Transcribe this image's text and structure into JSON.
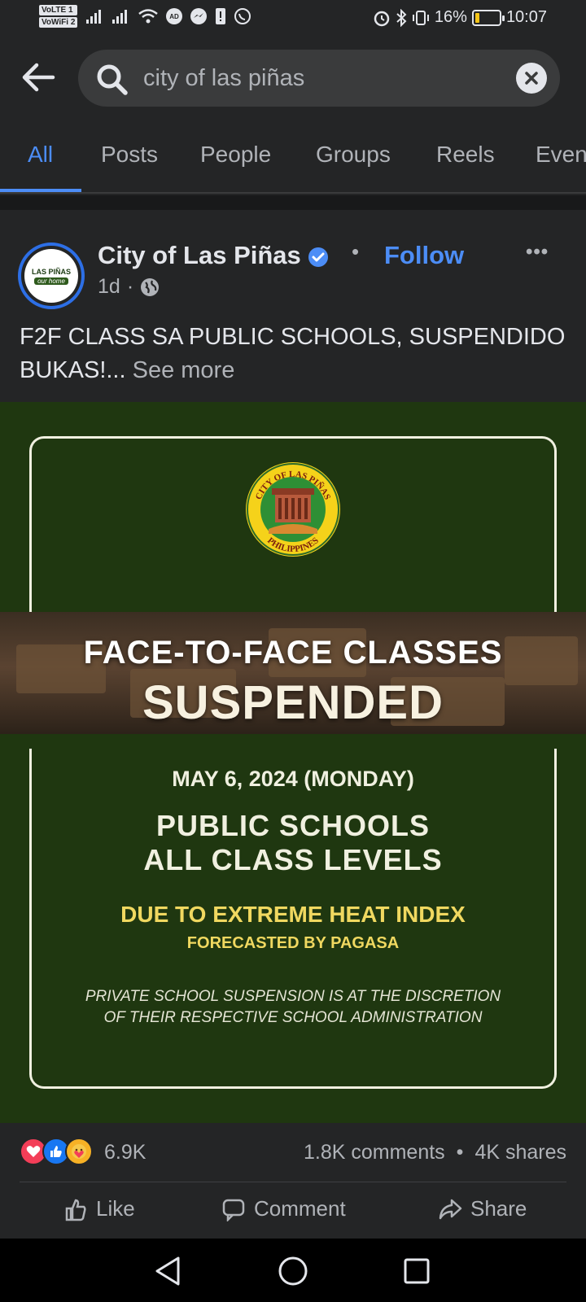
{
  "status_bar": {
    "volte": "VoLTE 1",
    "vowifi": "VoWiFi 2",
    "battery_percent": "16%",
    "battery_level": 0.16,
    "time": "10:07",
    "icons": [
      "signal-icon",
      "signal-icon",
      "wifi-icon",
      "ad-blocker-icon",
      "messenger-icon",
      "notification-icon",
      "viber-icon",
      "alarm-icon",
      "bluetooth-icon",
      "vibrate-icon",
      "battery-icon"
    ]
  },
  "search": {
    "value": "city of las piñas",
    "back_icon": "back-arrow-icon",
    "search_icon": "search-icon",
    "clear_icon": "clear-icon"
  },
  "tabs": [
    {
      "label": "All",
      "active": true
    },
    {
      "label": "Posts"
    },
    {
      "label": "People"
    },
    {
      "label": "Groups"
    },
    {
      "label": "Reels"
    },
    {
      "label": "Events"
    }
  ],
  "post": {
    "page_name": "City of Las Piñas",
    "verified": true,
    "follow_label": "Follow",
    "time": "1d",
    "privacy_icon": "globe-icon",
    "separator": "•",
    "meta_separator": "·",
    "more_label": "•••",
    "caption": "F2F CLASS SA PUBLIC SCHOOLS, SUSPENDIDO BUKAS!...",
    "see_more": "See more",
    "avatar": {
      "title": "LAS PIÑAS",
      "subtitle": "our home"
    },
    "image": {
      "seal_top_text": "CITY OF LAS PIÑAS",
      "seal_bottom_text": "PHILIPPINES",
      "banner_line1": "FACE-TO-FACE CLASSES",
      "banner_line2": "SUSPENDED",
      "date": "MAY 6, 2024 (MONDAY)",
      "line1": "PUBLIC SCHOOLS",
      "line2": "ALL CLASS LEVELS",
      "heat": "DUE TO EXTREME HEAT INDEX",
      "forecast": "FORECASTED BY PAGASA",
      "note1": "PRIVATE SCHOOL SUSPENSION IS AT THE DISCRETION",
      "note2": "OF THEIR RESPECTIVE SCHOOL ADMINISTRATION",
      "colors": {
        "background": "#1f3710",
        "accent_yellow": "#f0d860",
        "text": "#f0f0e0"
      }
    },
    "reactions": {
      "icons": [
        "love-reaction-icon",
        "like-reaction-icon",
        "care-reaction-icon"
      ],
      "count": "6.9K",
      "comments": "1.8K comments",
      "stats_separator": "•",
      "shares": "4K shares"
    },
    "actions": [
      "Like",
      "Comment",
      "Share"
    ]
  },
  "nav": {
    "back": "nav-back-icon",
    "home": "nav-home-icon",
    "recents": "nav-recents-icon"
  },
  "colors": {
    "background": "#242526",
    "accent": "#4c8df6",
    "text_primary": "#e4e6eb",
    "text_secondary": "#b0b3b8"
  }
}
